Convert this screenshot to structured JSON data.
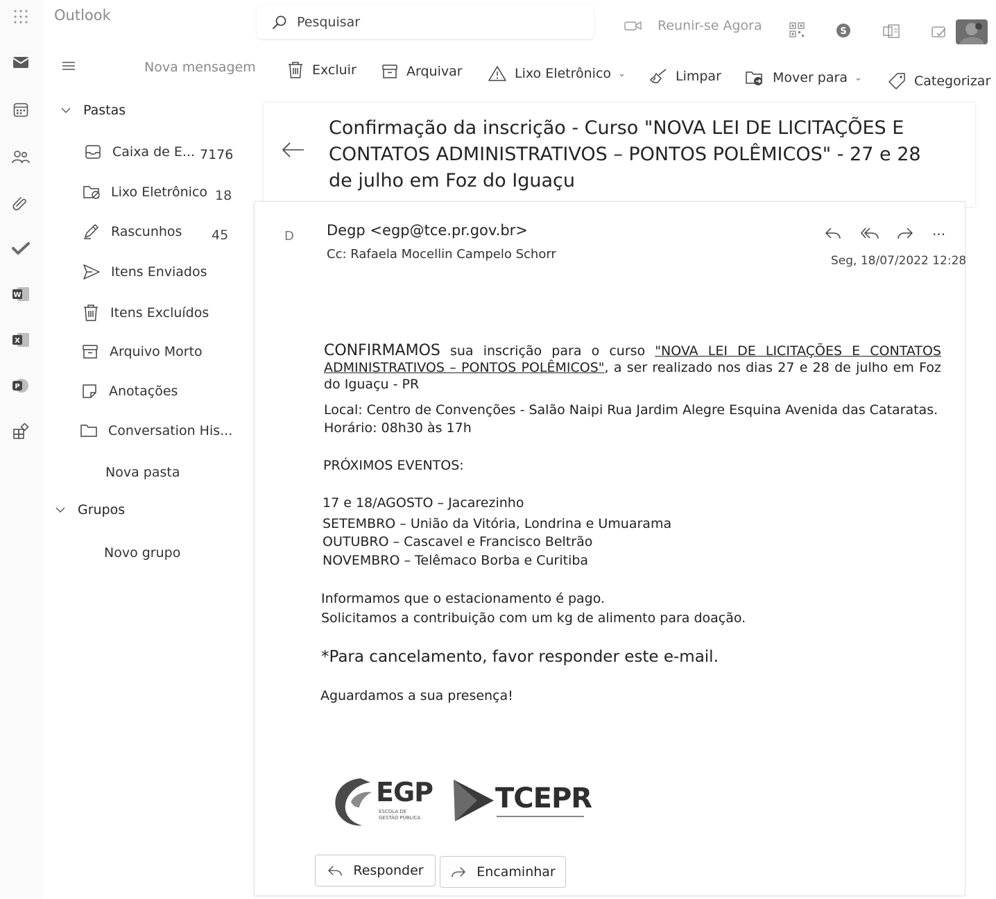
{
  "app": {
    "title": "Outlook"
  },
  "search": {
    "placeholder": "Pesquisar"
  },
  "header": {
    "meet_now": "Reunir-se Agora"
  },
  "toolbar": {
    "new_message": "Nova mensagem",
    "delete": "Excluir",
    "archive": "Arquivar",
    "junk": "Lixo Eletrônico",
    "sweep": "Limpar",
    "move_to": "Mover para",
    "categorize": "Categorizar"
  },
  "folders": {
    "section_label": "Pastas",
    "items": [
      {
        "label": "Caixa de E...",
        "count": "7176",
        "icon": "inbox-icon"
      },
      {
        "label": "Lixo Eletrônico",
        "count": "18",
        "icon": "junk-icon"
      },
      {
        "label": "Rascunhos",
        "count": "45",
        "icon": "drafts-icon"
      },
      {
        "label": "Itens Enviados",
        "count": "",
        "icon": "sent-icon"
      },
      {
        "label": "Itens Excluídos",
        "count": "",
        "icon": "trash-icon"
      },
      {
        "label": "Arquivo Morto",
        "count": "",
        "icon": "archive-icon"
      },
      {
        "label": "Anotações",
        "count": "",
        "icon": "note-icon"
      },
      {
        "label": "Conversation His...",
        "count": "",
        "icon": "folder-icon"
      }
    ],
    "new_folder": "Nova pasta"
  },
  "groups": {
    "section_label": "Grupos",
    "new_group": "Novo grupo"
  },
  "message": {
    "subject": "Confirmação da inscrição - Curso \"NOVA LEI DE LICITAÇÕES E CONTATOS ADMINISTRATIVOS – PONTOS POLÊMICOS\" - 27 e 28 de julho em Foz do Iguaçu",
    "avatar_initial": "D",
    "sender": "Degp <egp@tce.pr.gov.br>",
    "cc": "Cc:  Rafaela Mocellin Campelo Schorr",
    "date": "Seg, 18/07/2022 12:28",
    "body": {
      "confirm_word": "CONFIRMAMOS",
      "confirm_mid": " sua inscrição para o curso ",
      "course_link": "\"NOVA LEI DE LICITAÇÕES E CONTATOS ADMINISTRATIVOS – PONTOS POLÊMICOS\"",
      "confirm_end": ", a ser realizado nos dias 27 e 28 de julho em Foz do Iguaçu - PR",
      "location": "Local: Centro de Convenções - Salão Naipi  Rua Jardim Alegre Esquina Avenida das Cataratas.",
      "time": "Horário: 08h30 às 17h",
      "next_events_title": "PRÓXIMOS EVENTOS:",
      "events": [
        "17 e 18/AGOSTO – Jacarezinho",
        "SETEMBRO – União da Vitória, Londrina e Umuarama",
        "OUTUBRO – Cascavel e Francisco Beltrão",
        "NOVEMBRO – Telêmaco Borba e Curitiba"
      ],
      "parking": "Informamos que o estacionamento é pago.",
      "donation": "Solicitamos a contribuição com um kg de alimento para doação.",
      "cancel": "*Para cancelamento, favor responder este e-mail.",
      "closing": "Aguardamos a sua presença!"
    },
    "logos": {
      "egp_name": "EGP",
      "egp_sub": [
        "ESCOLA DE",
        "GESTÃO PÚBLICA"
      ],
      "tce_name": "TCEPR"
    },
    "reply_label": "Responder",
    "forward_label": "Encaminhar"
  }
}
